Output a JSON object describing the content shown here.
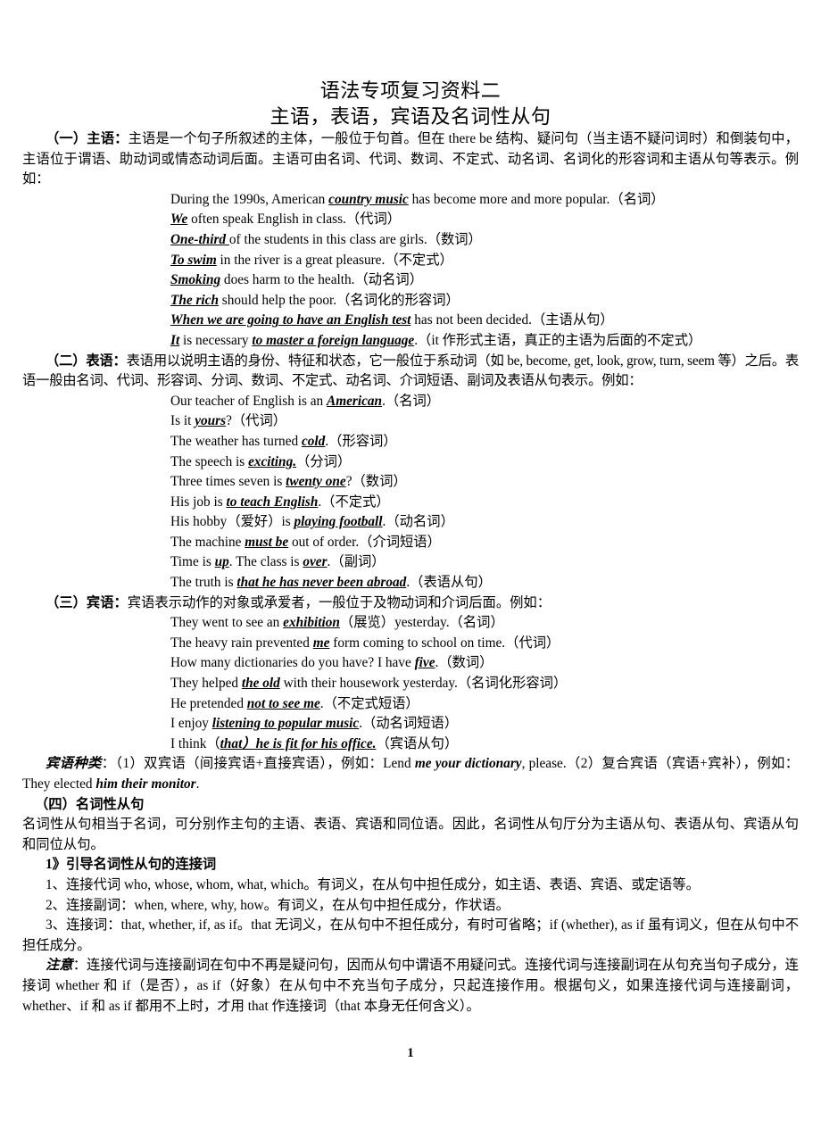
{
  "document": {
    "title": "语法专项复习资料二",
    "subtitle": "主语，表语，宾语及名词性从句",
    "page_number": "1"
  },
  "section_subject": {
    "label": "（一）主语：",
    "body": "主语是一个句子所叙述的主体，一般位于句首。但在 there be 结构、疑问句（当主语不疑问词时）和倒装句中，主语位于谓语、助动词或情态动词后面。主语可由名词、代词、数词、不定式、动名词、名词化的形容词和主语从句等表示。例如：",
    "examples": [
      {
        "pre": "During the 1990s, American ",
        "em": "country music",
        "post": " has become more and more popular.",
        "tag": "（名词）"
      },
      {
        "pre": "",
        "em": "We",
        "post": " often speak English in class.",
        "tag": "（代词）"
      },
      {
        "pre": "",
        "em": "One-third ",
        "post": "of the students in this class are girls.",
        "tag": "（数词）"
      },
      {
        "pre": "",
        "em": "To swim",
        "post": " in the river is a great pleasure.",
        "tag": "（不定式）"
      },
      {
        "pre": "",
        "em": "Smoking",
        "post": " does harm to the health.",
        "tag": "（动名词）"
      },
      {
        "pre": "",
        "em": "The rich",
        "post": " should help the poor.",
        "tag": "（名词化的形容词）"
      },
      {
        "pre": "",
        "em": "When we are going to have an English test",
        "post": " has not been decided.",
        "tag": "（主语从句）"
      },
      {
        "pre": "",
        "em": "It",
        "post": " is necessary ",
        "em2": "to master a foreign language",
        "post2": ".",
        "tag": "（it 作形式主语，真正的主语为后面的不定式）"
      }
    ]
  },
  "section_predicative": {
    "label": "（二）表语：",
    "body": "表语用以说明主语的身份、特征和状态，它一般位于系动词（如 be, become, get, look, grow, turn, seem 等）之后。表语一般由名词、代词、形容词、分词、数词、不定式、动名词、介词短语、副词及表语从句表示。例如：",
    "examples": [
      {
        "pre": "Our teacher of English is an ",
        "em": "American",
        "post": ".",
        "tag": "（名词）"
      },
      {
        "pre": "Is it ",
        "em": "yours",
        "post": "?",
        "tag": "（代词）"
      },
      {
        "pre": "The weather has turned ",
        "em": "cold",
        "post": ".",
        "tag": "（形容词）"
      },
      {
        "pre": "The speech is ",
        "em": "exciting.",
        "post": "",
        "tag": "（分词）"
      },
      {
        "pre": "Three times seven is ",
        "em": "twenty one",
        "post": "?",
        "tag": "（数词）"
      },
      {
        "pre": "His job is ",
        "em": "to teach English",
        "post": ".",
        "tag": "（不定式）"
      },
      {
        "pre": "His hobby（爱好）is ",
        "em": "playing football",
        "post": ".",
        "tag": "（动名词）"
      },
      {
        "pre": "The machine ",
        "em": "must be",
        "post": " out of order.",
        "tag": "（介词短语）"
      },
      {
        "pre": "Time is ",
        "em": "up",
        "post": ". The class is ",
        "em2": "over",
        "post2": ".",
        "tag": "（副词）"
      },
      {
        "pre": "The truth is ",
        "em": "that he has never been abroad",
        "post": ".",
        "tag": "（表语从句）"
      }
    ]
  },
  "section_object": {
    "label": "（三）宾语：",
    "body": "宾语表示动作的对象或承爱者，一般位于及物动词和介词后面。例如：",
    "examples": [
      {
        "pre": "They went to see an ",
        "em": "exhibition",
        "post": "（展览）yesterday.",
        "tag": "（名词）"
      },
      {
        "pre": "The heavy rain prevented ",
        "em": "me",
        "post": " form coming to school on time.",
        "tag": "（代词）"
      },
      {
        "pre": "How many dictionaries do you have? I have ",
        "em": "five",
        "post": ".",
        "tag": "（数词）"
      },
      {
        "pre": "They helped ",
        "em": "the old",
        "post": " with their housework yesterday.",
        "tag": "（名词化形容词）"
      },
      {
        "pre": "He pretended ",
        "em": "not to see me",
        "post": ".",
        "tag": "（不定式短语）"
      },
      {
        "pre": "I enjoy ",
        "em": "listening to popular music",
        "post": ".",
        "tag": "（动名词短语）"
      },
      {
        "pre": "I think（",
        "em": "that）he is fit for his office.",
        "post": "",
        "tag": "（宾语从句）"
      }
    ],
    "types_label": "宾语种类",
    "types_text_1": "：（1）双宾语（间接宾语+直接宾语），例如：Lend ",
    "types_em_1": "me your dictionary",
    "types_text_2": ", please.（2）复合宾语（宾语+宾补），例如：They elected ",
    "types_em_2": "him their monitor",
    "types_text_3": "."
  },
  "section_noun_clause": {
    "heading": "（四）名词性从句",
    "intro": "名词性从句相当于名词，可分别作主句的主语、表语、宾语和同位语。因此，名词性从句厅分为主语从句、表语从句、宾语从句和同位从句。",
    "sub_heading": "1》引导名词性从句的连接词",
    "item1": "1、连接代词 who, whose, whom, what, which。有词义，在从句中担任成分，如主语、表语、宾语、或定语等。",
    "item2": "2、连接副词：when, where, why, how。有词义，在从句中担任成分，作状语。",
    "item3": "3、连接词：that, whether, if, as if。that 无词义，在从句中不担任成分，有时可省略；if (whether), as if 虽有词义，但在从句中不担任成分。",
    "note_label": "注意",
    "note_text": "：连接代词与连接副词在句中不再是疑问句，因而从句中谓语不用疑问式。连接代词与连接副词在从句充当句子成分，连接词 whether 和 if（是否），as if（好象）在从句中不充当句子成分，只起连接作用。根据句义，如果连接代词与连接副词，whether、if 和 as if 都用不上时，才用 that 作连接词（that 本身无任何含义）。"
  }
}
